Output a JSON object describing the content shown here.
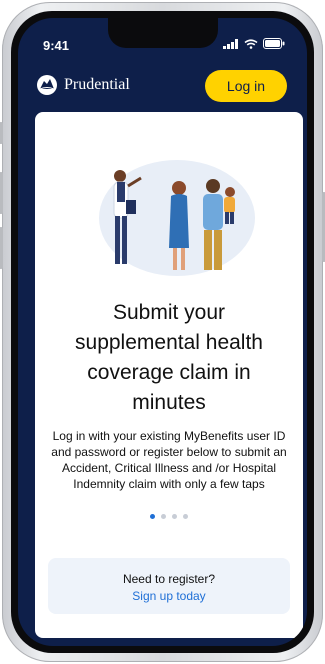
{
  "status_bar": {
    "time": "9:41"
  },
  "header": {
    "brand": "Prudential",
    "login_label": "Log in"
  },
  "main": {
    "headline": "Submit your supplemental health coverage claim in minutes",
    "body": "Log in with your existing MyBenefits user ID and password or register below to submit an Accident, Critical Illness and /or Hospital Indemnity claim with only a few taps",
    "carousel": {
      "total": 4,
      "active": 1
    }
  },
  "register": {
    "question": "Need to register?",
    "link": "Sign up today"
  },
  "colors": {
    "navy": "#0e1f4a",
    "yellow": "#ffd200",
    "link": "#1f6fd6",
    "panel": "#eef3fa"
  }
}
